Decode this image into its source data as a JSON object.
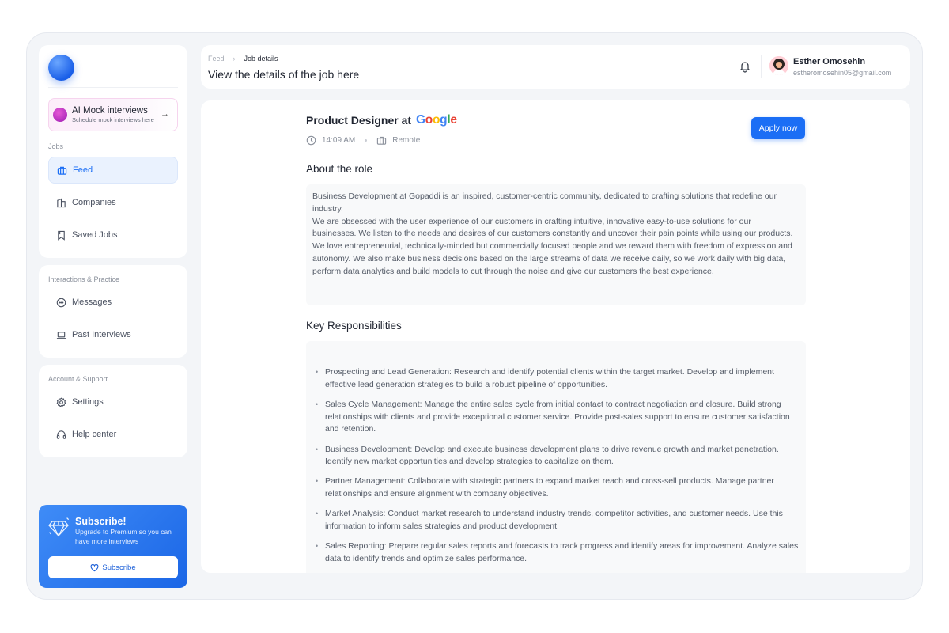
{
  "colors": {
    "accent": "#1b6ef5",
    "subscribe_bg": "#2f7df0"
  },
  "sidebar": {
    "mock_card": {
      "title": "AI Mock interviews",
      "subtitle": "Schedule mock interviews here",
      "icon": "arrow-right-icon"
    },
    "groups": [
      {
        "label": "Jobs",
        "items": [
          {
            "label": "Feed",
            "icon": "briefcase-icon",
            "active": true
          },
          {
            "label": "Companies",
            "icon": "building-icon",
            "active": false
          },
          {
            "label": "Saved Jobs",
            "icon": "bookmark-icon",
            "active": false
          }
        ]
      },
      {
        "label": "Interactions & Practice",
        "items": [
          {
            "label": "Messages",
            "icon": "chat-icon",
            "active": false
          },
          {
            "label": "Past Interviews",
            "icon": "laptop-icon",
            "active": false
          }
        ]
      },
      {
        "label": "Account & Support",
        "items": [
          {
            "label": "Settings",
            "icon": "gear-icon",
            "active": false
          },
          {
            "label": "Help center",
            "icon": "headset-icon",
            "active": false
          }
        ]
      }
    ],
    "subscribe": {
      "title": "Subscribe!",
      "text": "Upgrade to Premium so you can have more interviews",
      "button": "Subscribe"
    }
  },
  "header": {
    "breadcrumb": [
      "Feed",
      "Job details"
    ],
    "title": "View the details of the job here",
    "user": {
      "name": "Esther Omosehin",
      "email": "estheromosehin05@gmail.com"
    }
  },
  "job": {
    "title": "Product Designer at",
    "company": "Google",
    "time": "14:09 AM",
    "location": "Remote",
    "apply_label": "Apply now",
    "about_heading": "About the role",
    "about_paragraphs": [
      "Business Development at Gopaddi is an inspired, customer-centric community, dedicated to crafting solutions that redefine our industry.",
      "We are obsessed with the user experience of our customers in crafting intuitive, innovative easy-to-use solutions for our businesses. We listen to the needs and desires of our customers constantly and uncover their pain points while using our products.",
      "We love entrepreneurial, technically-minded but commercially focused people and we reward them with freedom of expression and autonomy. We also make business decisions based on the large streams of data we receive daily, so we work daily with big data, perform data analytics and build models to cut through the noise and give our customers the best experience."
    ],
    "resp_heading": "Key Responsibilities",
    "responsibilities": [
      "Prospecting and Lead Generation: Research and identify potential clients within the target market. Develop and implement effective lead generation strategies to build a robust pipeline of opportunities.",
      "Sales Cycle Management: Manage the entire sales cycle from initial contact to contract negotiation and closure. Build strong relationships with clients and provide exceptional customer service. Provide post-sales support to ensure customer satisfaction and retention.",
      "Business Development: Develop and execute business development plans to drive revenue growth and market penetration. Identify new market opportunities and develop strategies to capitalize on them.",
      "Partner Management: Collaborate with strategic partners to expand market reach and cross-sell products. Manage partner relationships and ensure alignment with company objectives.",
      "Market Analysis: Conduct market research to understand industry trends, competitor activities, and customer needs. Use this information to inform sales strategies and product development.",
      "Sales Reporting: Prepare regular sales reports and forecasts to track progress and identify areas for improvement. Analyze sales data to identify trends and optimize sales performance."
    ]
  }
}
